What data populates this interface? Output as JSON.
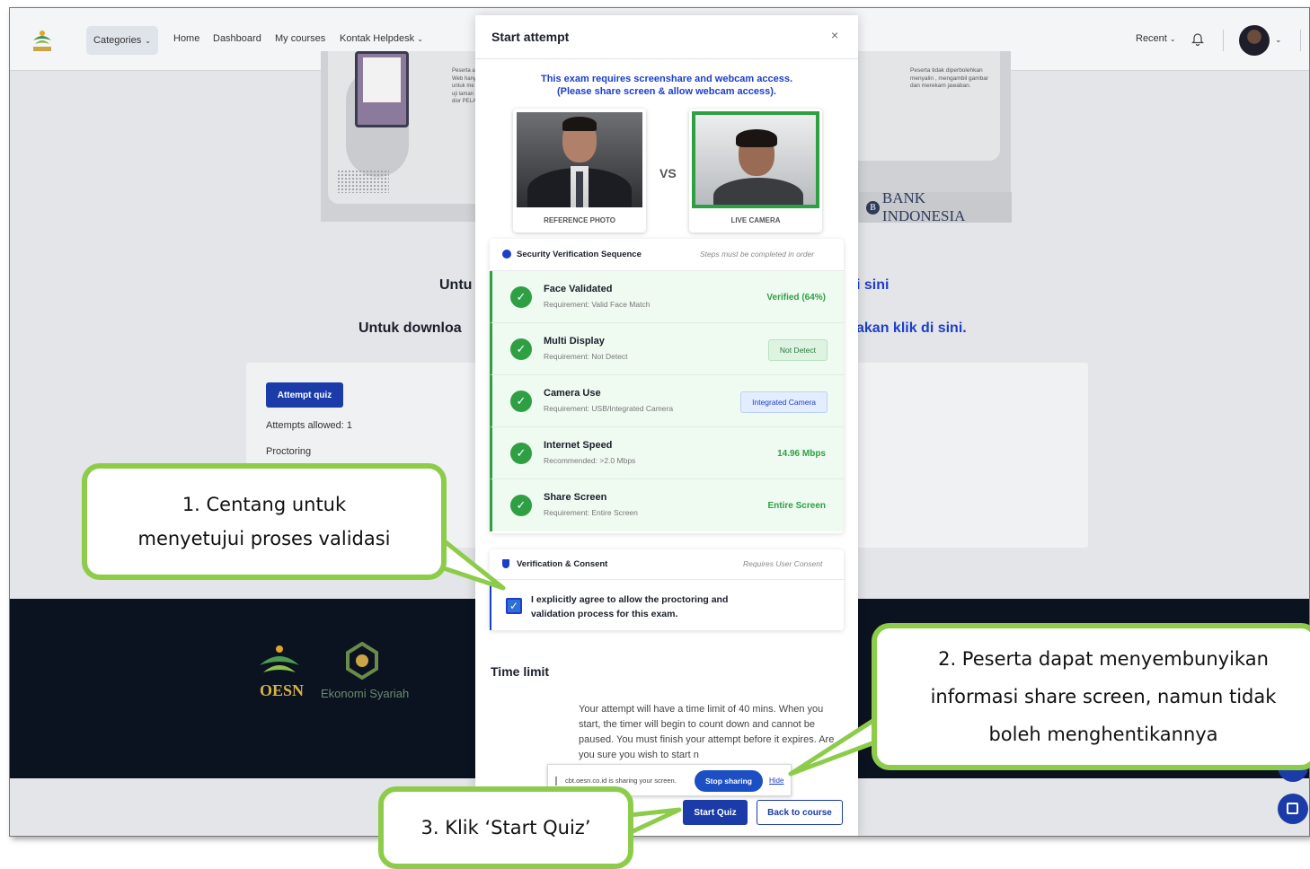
{
  "nav": {
    "categories": "Categories",
    "links": [
      "Home",
      "Dashboard",
      "My courses",
      "Kontak Helpdesk"
    ],
    "recent": "Recent"
  },
  "background": {
    "promo_left_text": "Peserta a oleh Web hanya di untuk me laman uji laman at akan dior PELANGG",
    "promo_right_text": "Peserta tidak diperbolehkan menyalin , mengambil gambar dan merekam jawaban.",
    "bank": "BANK INDONESIA",
    "heading_1_left": "Untu",
    "heading_1_right": "i sini",
    "heading_2_left": "Untuk downloa",
    "heading_2_right": "akan klik di sini.",
    "attempt_quiz": "Attempt quiz",
    "attempts_allowed": "Attempts allowed: 1",
    "proctoring": "Proctoring",
    "footer_oesn": "OESN",
    "footer_eko": "Ekonomi Syariah"
  },
  "modal": {
    "title": "Start attempt",
    "close": "×",
    "exam_req_line1": "This exam requires screenshare and webcam access.",
    "exam_req_line2": "(Please share screen & allow webcam access).",
    "reference_caption": "REFERENCE PHOTO",
    "vs": "VS",
    "live_caption": "LIVE CAMERA",
    "security": {
      "title": "Security Verification Sequence",
      "note": "Steps must be completed in order",
      "steps": [
        {
          "title": "Face Validated",
          "req": "Requirement: Valid Face Match",
          "status": "Verified (64%)"
        },
        {
          "title": "Multi Display",
          "req": "Requirement: Not Detect",
          "status": "Not Detect"
        },
        {
          "title": "Camera Use",
          "req": "Requirement: USB/Integrated Camera",
          "status": "Integrated Camera"
        },
        {
          "title": "Internet Speed",
          "req": "Recommended: >2.0 Mbps",
          "status": "14.96 Mbps"
        },
        {
          "title": "Share Screen",
          "req": "Requirement: Entire Screen",
          "status": "Entire Screen"
        }
      ]
    },
    "consent": {
      "title": "Verification & Consent",
      "note": "Requires User Consent",
      "text": "I explicitly agree to allow the proctoring and validation process for this exam.",
      "checked": true
    },
    "time_limit_heading": "Time limit",
    "time_limit_text": "Your attempt will have a time limit of 40 mins. When you start, the timer will begin to count down and cannot be paused. You must finish your attempt before it expires. Are you sure you wish to start n",
    "share_banner": {
      "text": "cbt.oesn.co.id is sharing your screen.",
      "stop": "Stop sharing",
      "hide": "Hide"
    },
    "start_quiz": "Start Quiz",
    "back_to_course": "Back to course"
  },
  "callouts": {
    "c1_line1": "1. Centang untuk",
    "c1_line2": "menyetujui proses validasi",
    "c2_line1": "2. Peserta dapat menyembunyikan",
    "c2_line2": "informasi share screen, namun tidak",
    "c2_line3": "boleh menghentikannya",
    "c3": "3. Klik ‘Start Quiz’"
  },
  "colors": {
    "primary": "#1a3ba8",
    "success": "#2ea043",
    "callout_border": "#8dcc4b"
  }
}
